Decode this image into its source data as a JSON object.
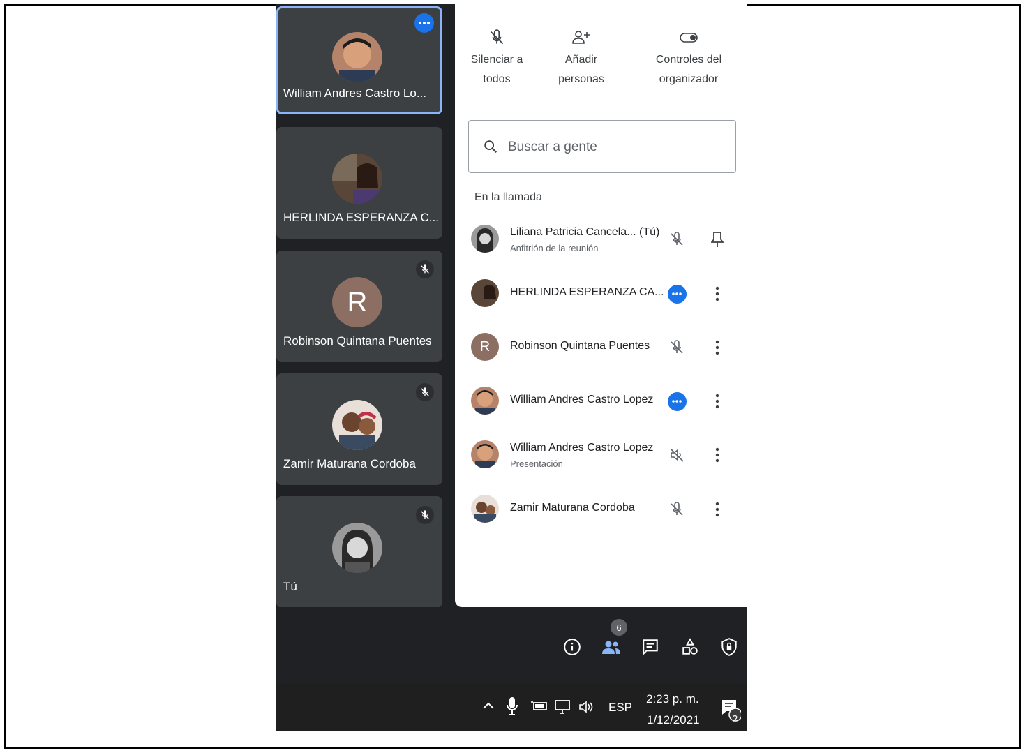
{
  "tiles": [
    {
      "name": "William Andres Castro Lo..."
    },
    {
      "name": "HERLINDA ESPERANZA C..."
    },
    {
      "name": "Robinson Quintana Puentes",
      "initial": "R"
    },
    {
      "name": "Zamir Maturana Cordoba"
    },
    {
      "name": "Tú"
    }
  ],
  "panel": {
    "actions": [
      {
        "label_1": "Silenciar a",
        "label_2": "todos",
        "icon": "mic-off-icon"
      },
      {
        "label_1": "Añadir",
        "label_2": "personas",
        "icon": "person-add-icon"
      },
      {
        "label_1": "Controles del",
        "label_2": "organizador",
        "icon": "toggle-icon"
      }
    ],
    "search_placeholder": "Buscar a gente",
    "section_title": "En la llamada",
    "participants": [
      {
        "name": "Liliana Patricia Cancela... (Tú)",
        "subtitle": "Anfitrión de la reunión",
        "status": "mic-off",
        "action": "pin"
      },
      {
        "name": "HERLINDA ESPERANZA CA...",
        "status": "more",
        "action": "menu"
      },
      {
        "name": "Robinson Quintana Puentes",
        "initial": "R",
        "status": "mic-off",
        "action": "menu"
      },
      {
        "name": "William Andres Castro Lopez",
        "status": "more",
        "action": "menu"
      },
      {
        "name": "William Andres Castro Lopez",
        "subtitle": "Presentación",
        "status": "volume-off",
        "action": "menu"
      },
      {
        "name": "Zamir Maturana Cordoba",
        "status": "mic-off",
        "action": "menu"
      }
    ]
  },
  "toolbar": {
    "people_count": "6"
  },
  "taskbar": {
    "language": "ESP",
    "time": "2:23 p. m.",
    "date": "1/12/2021",
    "notification_count": "2"
  },
  "colors": {
    "accent": "#1a73e8",
    "tile_bg": "#3c4043",
    "meeting_bg": "#202124",
    "active_border": "#8ab4f8"
  }
}
